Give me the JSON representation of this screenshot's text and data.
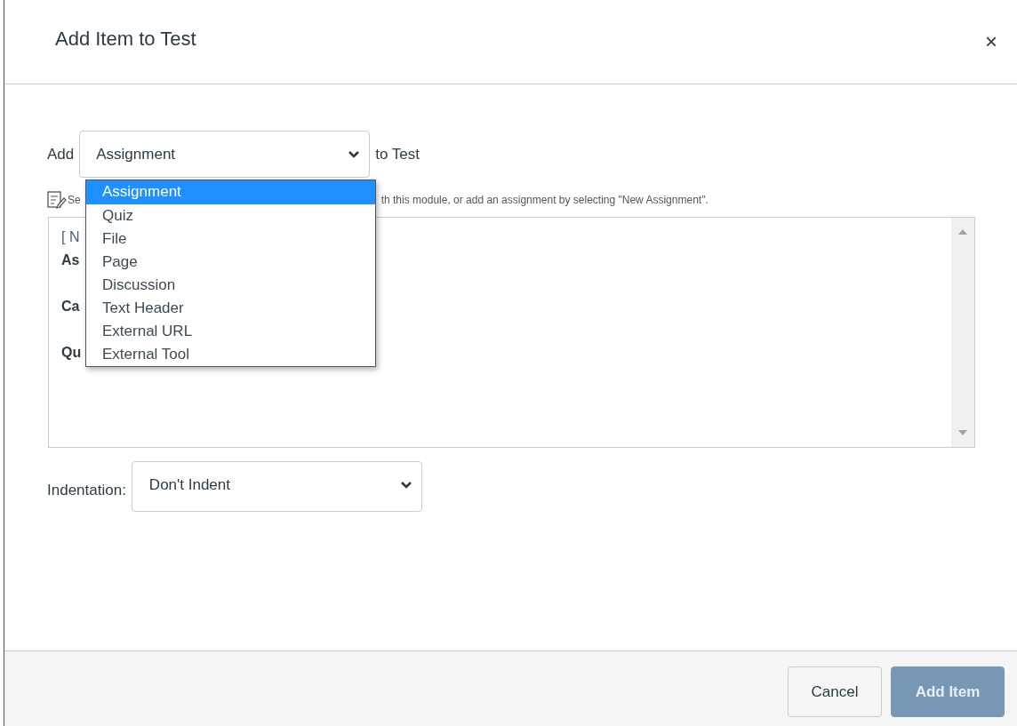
{
  "dialog": {
    "title": "Add Item to Test",
    "close": "×"
  },
  "add_row": {
    "prefix": "Add",
    "value": "Assignment",
    "suffix": "to Test",
    "options": [
      {
        "label": "Assignment",
        "selected": true
      },
      {
        "label": "Quiz",
        "selected": false
      },
      {
        "label": "File",
        "selected": false
      },
      {
        "label": "Page",
        "selected": false
      },
      {
        "label": "Discussion",
        "selected": false
      },
      {
        "label": "Text Header",
        "selected": false
      },
      {
        "label": "External URL",
        "selected": false
      },
      {
        "label": "External Tool",
        "selected": false
      }
    ]
  },
  "hint": {
    "start": "Se",
    "end": "th this module, or add an assignment by selecting \"New Assignment\"."
  },
  "listbox": {
    "rows": [
      {
        "kind": "placeholder",
        "text": "[ N"
      },
      {
        "kind": "group",
        "text": "As"
      },
      {
        "kind": "group",
        "text": "Ca"
      },
      {
        "kind": "group",
        "text": "Qu"
      }
    ]
  },
  "indentation": {
    "label": "Indentation:",
    "value": "Don't Indent"
  },
  "buttons": [
    {
      "label": "Cancel",
      "kind": "secondary",
      "disabled": false
    },
    {
      "label": "Add Item",
      "kind": "primary",
      "disabled": true
    }
  ]
}
